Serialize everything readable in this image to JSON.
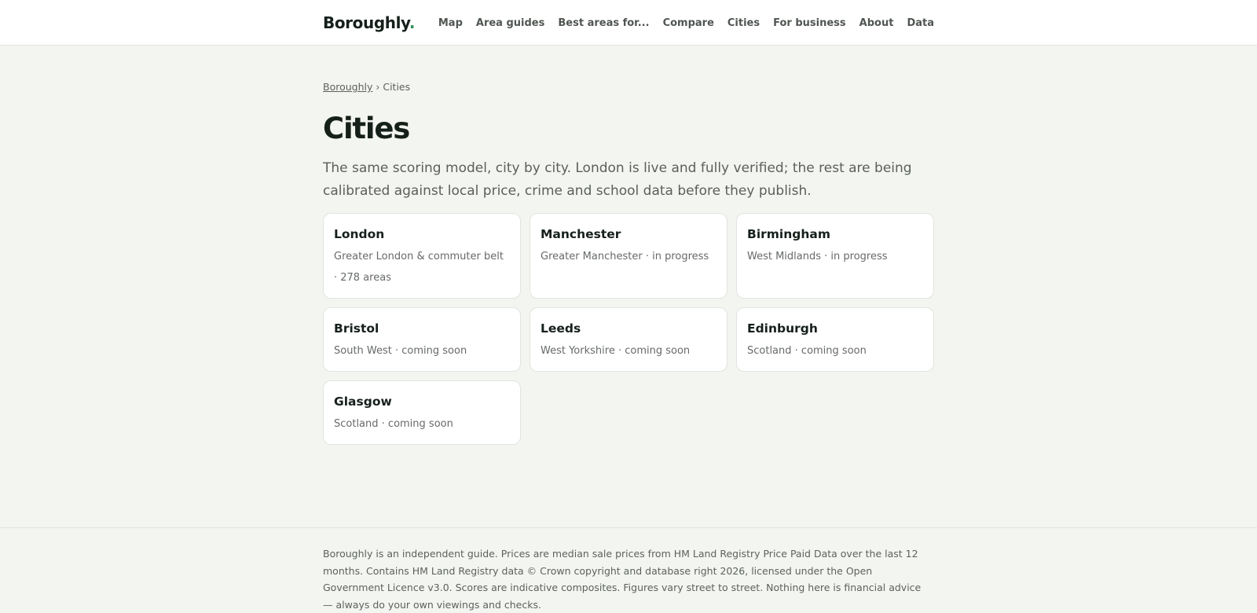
{
  "header": {
    "logo_text": "Boroughly",
    "logo_dot": ".",
    "nav": [
      {
        "label": "Map"
      },
      {
        "label": "Area guides"
      },
      {
        "label": "Best areas for..."
      },
      {
        "label": "Compare"
      },
      {
        "label": "Cities"
      },
      {
        "label": "For business"
      },
      {
        "label": "About"
      },
      {
        "label": "Data"
      }
    ]
  },
  "breadcrumb": {
    "home": "Boroughly",
    "separator": "›",
    "current": "Cities"
  },
  "page": {
    "title": "Cities",
    "lede": "The same scoring model, city by city. London is live and fully verified; the rest are being calibrated against local price, crime and school data before they publish."
  },
  "cities": [
    {
      "name": "London",
      "meta": "Greater London & commuter belt · 278 areas"
    },
    {
      "name": "Manchester",
      "meta": "Greater Manchester · in progress"
    },
    {
      "name": "Birmingham",
      "meta": "West Midlands · in progress"
    },
    {
      "name": "Bristol",
      "meta": "South West · coming soon"
    },
    {
      "name": "Leeds",
      "meta": "West Yorkshire · coming soon"
    },
    {
      "name": "Edinburgh",
      "meta": "Scotland · coming soon"
    },
    {
      "name": "Glasgow",
      "meta": "Scotland · coming soon"
    }
  ],
  "footer": {
    "text": "Boroughly is an independent guide. Prices are median sale prices from HM Land Registry Price Paid Data over the last 12 months. Contains HM Land Registry data © Crown copyright and database right 2026, licensed under the Open Government Licence v3.0. Scores are indicative composites. Figures vary street to street. Nothing here is financial advice — always do your own viewings and checks."
  },
  "colors": {
    "background": "#f3f5f1",
    "surface": "#ffffff",
    "accent": "#2f8f5b",
    "text": "#16201b",
    "muted": "#5d625e"
  }
}
